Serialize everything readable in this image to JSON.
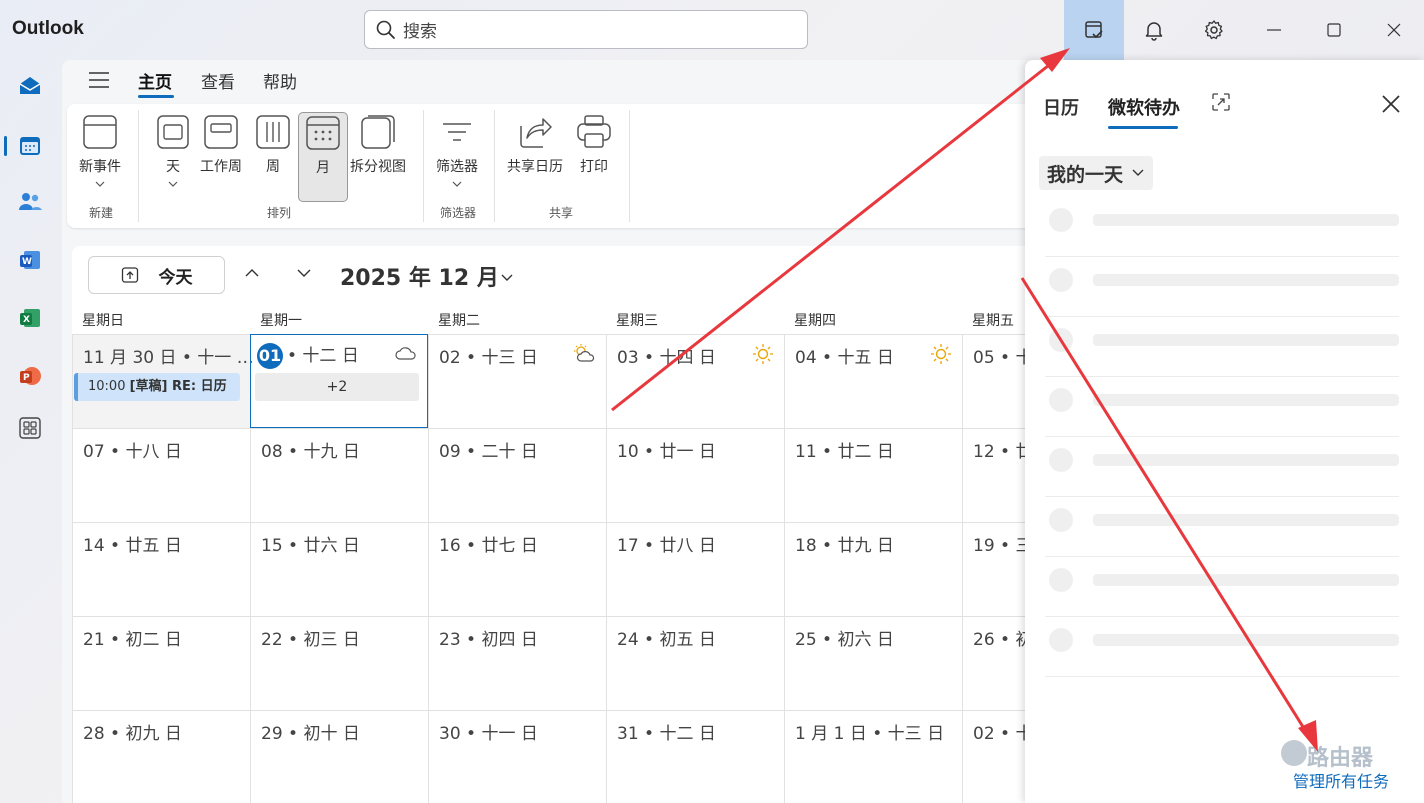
{
  "app": {
    "title": "Outlook"
  },
  "search": {
    "placeholder": "搜索"
  },
  "nav_tabs": {
    "home": "主页",
    "view": "查看",
    "help": "帮助"
  },
  "ribbon": {
    "new_event": "新事件",
    "group_new": "新建",
    "day": "天",
    "work_week": "工作周",
    "week": "周",
    "month": "月",
    "split_view": "拆分视图",
    "group_arrange": "排列",
    "filter": "筛选器",
    "group_filter": "筛选器",
    "share_calendar": "共享日历",
    "print": "打印",
    "group_share": "共享"
  },
  "calendar": {
    "today_label": "今天",
    "month_title": "2025 年 12 月",
    "weekdays": [
      "星期日",
      "星期一",
      "星期二",
      "星期三",
      "星期四",
      "星期五"
    ],
    "weeks": [
      [
        "11 月 30 日 • 十一 …",
        "• 十二 日",
        "02 • 十三 日",
        "03 • 十四 日",
        "04 • 十五 日",
        "05 • 十"
      ],
      [
        "07 • 十八 日",
        "08 • 十九 日",
        "09 • 二十 日",
        "10 • 廿一 日",
        "11 • 廿二 日",
        "12 • 廿"
      ],
      [
        "14 • 廿五 日",
        "15 • 廿六 日",
        "16 • 廿七 日",
        "17 • 廿八 日",
        "18 • 廿九 日",
        "19 • 三"
      ],
      [
        "21 • 初二 日",
        "22 • 初三 日",
        "23 • 初四 日",
        "24 • 初五 日",
        "25 • 初六 日",
        "26 • 初"
      ],
      [
        "28 • 初九 日",
        "29 • 初十 日",
        "30 • 十一 日",
        "31 • 十二 日",
        "1 月 1 日 • 十三 日",
        "02 • 十"
      ]
    ],
    "today_number": "01",
    "event": {
      "time": "10:00",
      "title": "[草稿] RE: 日历"
    },
    "more_events": "+2"
  },
  "pane": {
    "tab_calendar": "日历",
    "tab_todo": "微软待办",
    "my_day": "我的一天",
    "manage_tasks": "管理所有任务",
    "watermark": "路由器"
  },
  "colors": {
    "accent": "#0f6cbd",
    "arrow": "#e8383d"
  }
}
